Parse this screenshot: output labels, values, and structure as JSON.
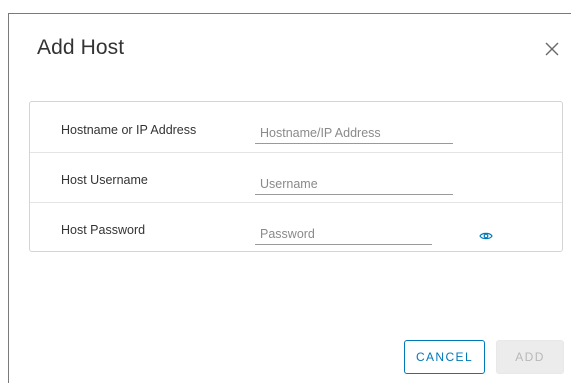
{
  "dialog": {
    "title": "Add Host",
    "close_icon": "close-icon"
  },
  "form": {
    "fields": [
      {
        "label": "Hostname or IP Address",
        "placeholder": "Hostname/IP Address",
        "value": "",
        "type": "text"
      },
      {
        "label": "Host Username",
        "placeholder": "Username",
        "value": "",
        "type": "text"
      },
      {
        "label": "Host Password",
        "placeholder": "Password",
        "value": "",
        "type": "password",
        "toggle_icon": "eye-icon"
      }
    ]
  },
  "footer": {
    "cancel_label": "CANCEL",
    "add_label": "ADD",
    "add_disabled": true
  },
  "colors": {
    "accent": "#0079b8",
    "disabled_bg": "#ececec",
    "disabled_text": "#b8b8b8",
    "text": "#333333",
    "placeholder": "#8a8a8a"
  }
}
